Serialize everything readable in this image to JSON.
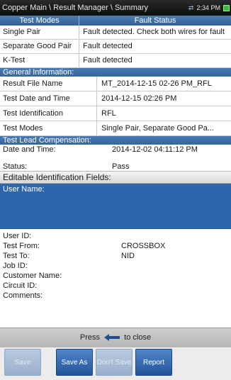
{
  "header": {
    "breadcrumb": "Copper Main \\ Result Manager \\ Summary",
    "time": "2:34 PM"
  },
  "test_table": {
    "columns": [
      "Test Modes",
      "Fault Status"
    ],
    "rows": [
      {
        "mode": "Single Pair",
        "status": "Fault detected. Check both wires for fault"
      },
      {
        "mode": "Separate Good Pair",
        "status": "Fault detected"
      },
      {
        "mode": "K-Test",
        "status": "Fault detected"
      }
    ]
  },
  "general_info": {
    "heading": "General Information:",
    "rows": [
      {
        "label": "Result File Name",
        "value": "MT_2014-12-15 02-26 PM_RFL"
      },
      {
        "label": "Test Date and Time",
        "value": "2014-12-15 02:26 PM"
      },
      {
        "label": "Test Identification",
        "value": "RFL"
      },
      {
        "label": "Test Modes",
        "value": "Single Pair, Separate Good Pa..."
      }
    ]
  },
  "lead_comp": {
    "heading": "Test Lead Compensation:",
    "rows": [
      {
        "label": "Date and Time:",
        "value": "2014-12-02 04:11:12 PM"
      },
      {
        "label": "Status:",
        "value": "Pass"
      }
    ]
  },
  "editable": {
    "heading": "Editable Identification Fields:",
    "user_name_label": "User Name:",
    "user_name_value": "",
    "fields": [
      {
        "label": "User ID:",
        "value": ""
      },
      {
        "label": "Test From:",
        "value": "CROSSBOX"
      },
      {
        "label": "Test To:",
        "value": "NID"
      },
      {
        "label": "Job ID:",
        "value": ""
      },
      {
        "label": "Customer Name:",
        "value": ""
      },
      {
        "label": "Circuit ID:",
        "value": ""
      },
      {
        "label": "Comments:",
        "value": ""
      }
    ]
  },
  "footer": {
    "press_text": "Press",
    "close_text": "to close",
    "icons": {
      "back_arrow": "back-arrow-icon",
      "network": "network-icon",
      "battery": "battery-icon"
    },
    "buttons": {
      "save": "Save",
      "save_as": "Save As",
      "dont_save": "Don't Save",
      "report": "Report"
    }
  },
  "colors": {
    "header_blue": "#3565a0",
    "selected_field": "#2f66ab",
    "button_blue": "#23549a"
  }
}
